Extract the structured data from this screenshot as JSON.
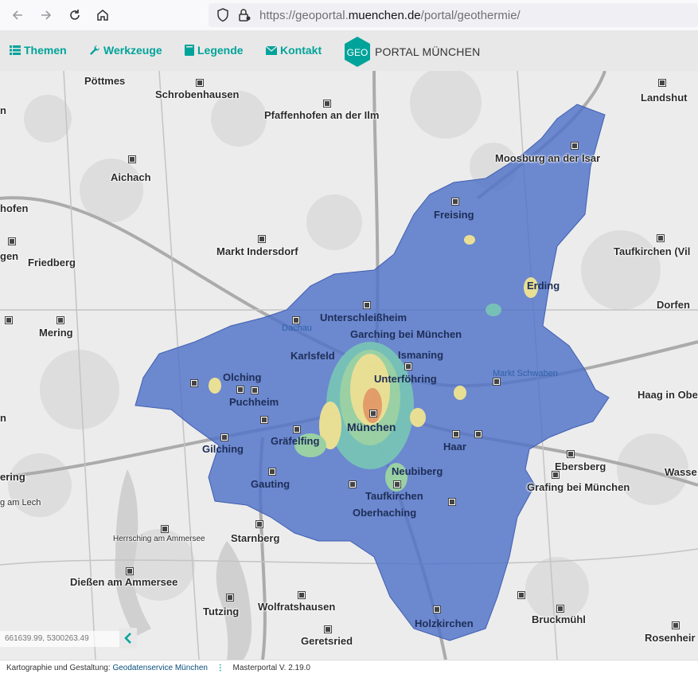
{
  "browser": {
    "url_prefix": "https://geoportal.",
    "url_domain": "muenchen.de",
    "url_path": "/portal/geothermie/"
  },
  "menu": {
    "themen": "Themen",
    "werkzeuge": "Werkzeuge",
    "legende": "Legende",
    "kontakt": "Kontakt"
  },
  "logo": {
    "badge": "GEO",
    "text": "PORTAL MÜNCHEN"
  },
  "map": {
    "places": {
      "poettmes": "Pöttmes",
      "schrobenhausen": "Schrobenhausen",
      "pfaffenhofen": "Pfaffenhofen an der Ilm",
      "landshut": "Landshut",
      "aichach": "Aichach",
      "moosburg": "Moosburg an der Isar",
      "hofen": "hofen",
      "freising": "Freising",
      "gen": "gen",
      "friedberg": "Friedberg",
      "markt_indersdorf": "Markt Indersdorf",
      "taufkirchen_vils": "Taufkirchen (Vil",
      "erding": "Erding",
      "dorfen": "Dorfen",
      "mering": "Mering",
      "unterschleissheim": "Unterschleißheim",
      "dachau": "Dachau",
      "garching": "Garching bei München",
      "karlsfeld": "Karlsfeld",
      "ismaning": "Ismaning",
      "unterfoehring": "Unterföhring",
      "olching": "Olching",
      "markt_schwaben": "Markt Schwaben",
      "puchheim": "Puchheim",
      "haag": "Haag in Obe",
      "muenchen": "München",
      "graefelfing": "Gräfelfing",
      "haar": "Haar",
      "gilching": "Gilching",
      "ebersberg": "Ebersberg",
      "ering": "ering",
      "neubiberg": "Neubiberg",
      "grafing": "Grafing bei München",
      "wasse": "Wasse",
      "gauting": "Gauting",
      "taufkirchen": "Taufkirchen",
      "g_am_lech": "g am Lech",
      "oberhaching": "Oberhaching",
      "herrsching": "Herrsching am Ammersee",
      "starnberg": "Starnberg",
      "diessen": "Dießen am Ammersee",
      "tutzing": "Tutzing",
      "wolfratshausen": "Wolfratshausen",
      "holzkirchen": "Holzkirchen",
      "bruckmuehl": "Bruckmühl",
      "geretsried": "Geretsried",
      "rosenheim": "Rosenheir",
      "n1": "n",
      "n2": "n"
    },
    "coordinates": "661639.99, 5300263.49"
  },
  "footer": {
    "credit_label": "Kartographie und Gestaltung:",
    "credit_link": "Geodatenservice München",
    "version": "Masterportal V. 2.19.0"
  },
  "colors": {
    "accent": "#00a39a",
    "overlay_base": "#4f72c8",
    "heat_mid": "#9fd8a0",
    "heat_high": "#f7e98e",
    "heat_peak": "#f0a060"
  }
}
